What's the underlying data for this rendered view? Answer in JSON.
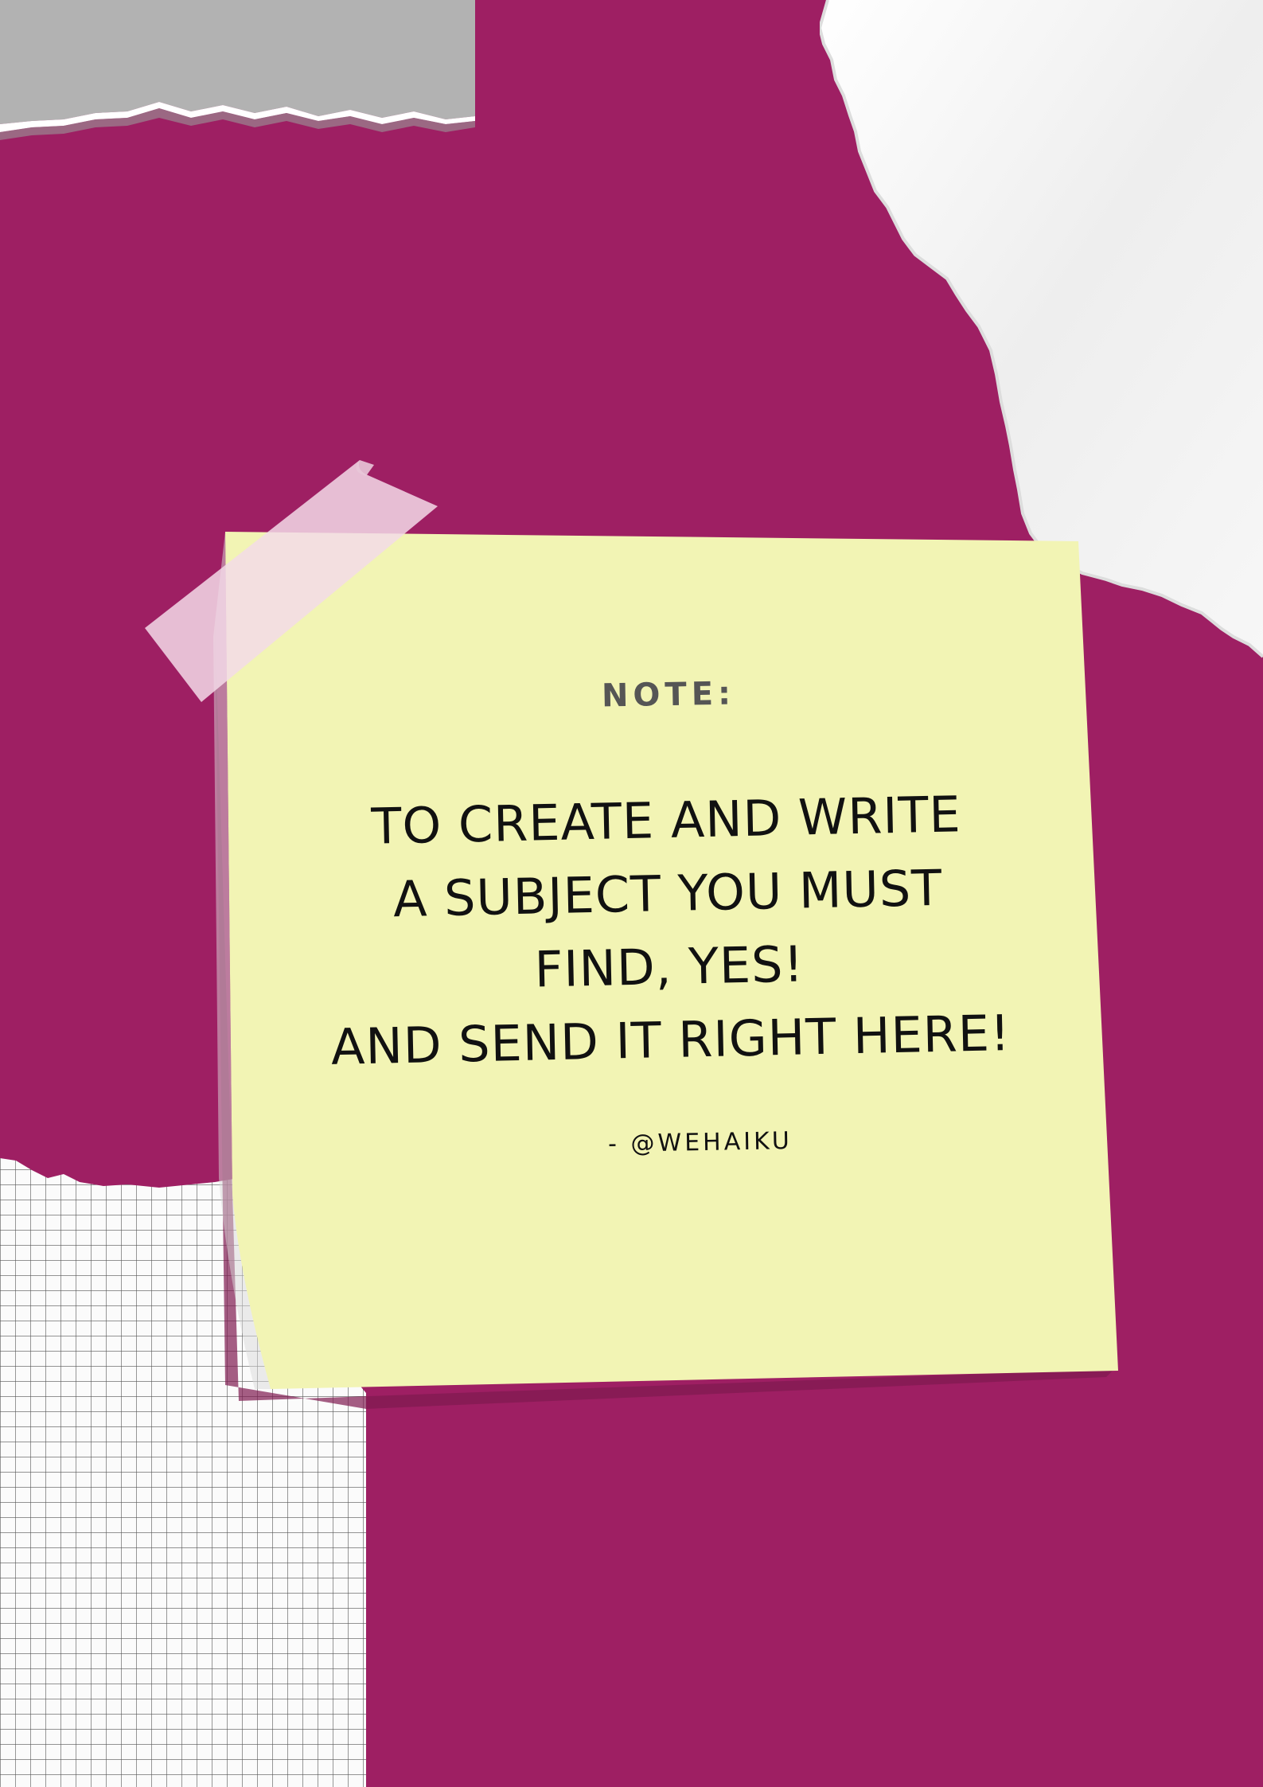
{
  "note": {
    "label": "NOTE:",
    "lines": [
      "TO CREATE AND WRITE",
      "A SUBJECT YOU MUST",
      "FIND, YES!",
      "AND SEND IT RIGHT HERE!"
    ],
    "author": "- @WEHAIKU"
  },
  "colors": {
    "background": "#9e1f63",
    "note": "#f2f4b4",
    "tape": "#f3dbe8",
    "grey_paper": "#b2b2b2",
    "white_paper": "#f4f4f4"
  }
}
